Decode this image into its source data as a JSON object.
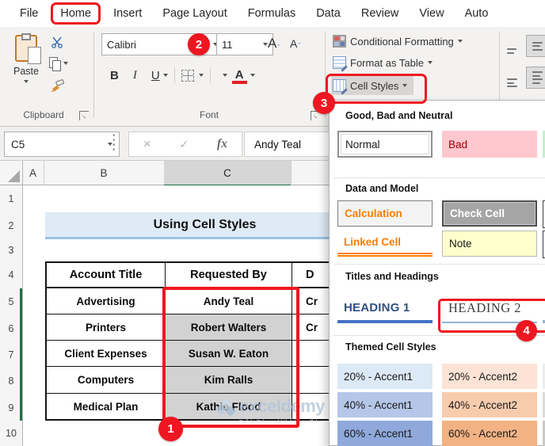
{
  "window": {
    "tabs": [
      "File",
      "Home",
      "Insert",
      "Page Layout",
      "Formulas",
      "Data",
      "Review",
      "View",
      "Auto"
    ],
    "active_tab": "Home"
  },
  "ribbon": {
    "paste_label": "Paste",
    "clipboard_group_label": "Clipboard",
    "font_group_label": "Font",
    "font_name": "Calibri",
    "font_size": "11",
    "grow_font": "A",
    "shrink_font": "A",
    "bold": "B",
    "italic": "I",
    "underline": "U",
    "font_color_letter": "A",
    "conditional_formatting": "Conditional Formatting",
    "format_as_table": "Format as Table",
    "cell_styles": "Cell Styles"
  },
  "formula_bar": {
    "name_box": "C5",
    "cancel_glyph": "×",
    "enter_glyph": "✓",
    "fx_label": "fx",
    "value": "Andy Teal"
  },
  "sheet": {
    "column_headers": [
      "A",
      "B",
      "C"
    ],
    "row_headers": [
      "1",
      "2",
      "3",
      "4",
      "5",
      "6",
      "7",
      "8",
      "9",
      "10"
    ],
    "banner_title": "Using Cell Styles",
    "table": {
      "headers": {
        "b": "Account Title",
        "c": "Requested By",
        "d": "D"
      },
      "rows": [
        {
          "b": "Advertising",
          "c": "Andy Teal",
          "d": "Cr"
        },
        {
          "b": "Printers",
          "c": "Robert Walters",
          "d": "Cr"
        },
        {
          "b": "Client Expenses",
          "c": "Susan W. Eaton",
          "d": ""
        },
        {
          "b": "Computers",
          "c": "Kim Ralls",
          "d": ""
        },
        {
          "b": "Medical Plan",
          "c": "Kathie Flood",
          "d": ""
        }
      ]
    },
    "watermark": {
      "brand": "exceldemy",
      "tagline": "EXCEL · DATA · BI"
    }
  },
  "styles_panel": {
    "sections": {
      "good_bad_neutral": {
        "title": "Good, Bad and Neutral",
        "normal": "Normal",
        "bad": "Bad"
      },
      "data_model": {
        "title": "Data and Model",
        "calculation": "Calculation",
        "check_cell": "Check Cell",
        "linked_cell": "Linked Cell",
        "note": "Note"
      },
      "titles_headings": {
        "title": "Titles and Headings",
        "heading1": "HEADING 1",
        "heading2": "HEADING 2"
      },
      "themed": {
        "title": "Themed Cell Styles",
        "tiles": [
          "20% - Accent1",
          "20% - Accent2",
          "40% - Accent1",
          "40% - Accent2",
          "60% - Accent1",
          "60% - Accent2"
        ]
      }
    }
  },
  "annotations": {
    "step1": "1",
    "step2": "2",
    "step3": "3",
    "step4": "4"
  },
  "colors": {
    "annotation_red": "#ee1620",
    "excel_green": "#1e7145",
    "selected_range_gray": "#d2d2d2",
    "banner_bg": "#deebf6",
    "banner_border": "#9bc2e6",
    "bad_bg": "#ffc7ce",
    "bad_text": "#9c0006",
    "good_bg": "#c6efce",
    "calculation_text": "#fa7d00",
    "check_cell_bg": "#a5a5a5",
    "note_bg": "#ffffcc",
    "heading1_underline": "#4472c4",
    "heading2_underline": "#95b3d7",
    "accent1_20": "#dce9f6",
    "accent2_20": "#fce3d5",
    "accent1_40": "#b5c7e8",
    "accent2_40": "#f8cbad",
    "accent1_60": "#8fa9dc",
    "accent2_60": "#f2b283"
  }
}
